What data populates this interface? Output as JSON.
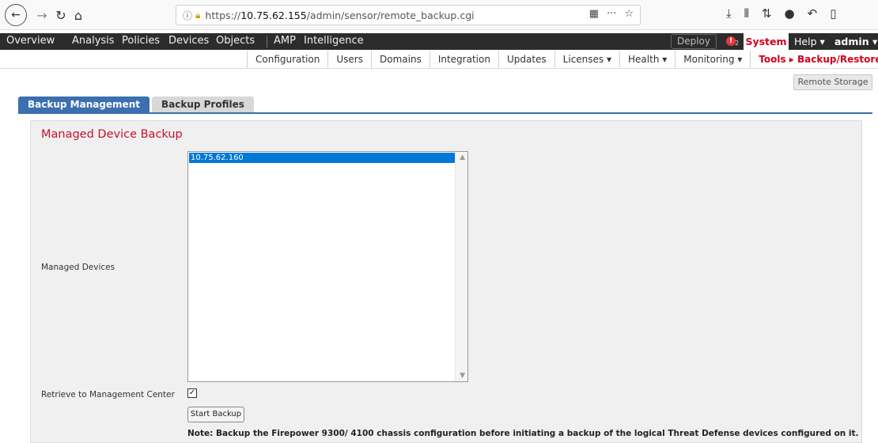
{
  "browser": {
    "url_prefix": "https://",
    "url_host": "10.75.62.155",
    "url_path": "/admin/sensor/remote_backup.cgi",
    "icons": [
      "back-icon",
      "forward-icon",
      "reload-icon",
      "home-icon",
      "info-icon",
      "lock-icon",
      "qr-icon",
      "more-icon",
      "star-icon",
      "download-icon",
      "library-icon",
      "sync-icon",
      "chat-icon",
      "undo-icon",
      "sidebar-icon"
    ]
  },
  "topnav": {
    "items": [
      "Overview",
      "Analysis",
      "Policies",
      "Devices",
      "Objects",
      "AMP",
      "Intelligence"
    ],
    "deploy_label": "Deploy",
    "alert_count": "2",
    "system_label": "System",
    "help_label": "Help ▾",
    "admin_label": "admin ▾"
  },
  "subnav": {
    "items": [
      "Configuration",
      "Users",
      "Domains",
      "Integration",
      "Updates",
      "Licenses ▾",
      "Health ▾",
      "Monitoring ▾"
    ],
    "active_label": "Tools ▸ Backup/Restore"
  },
  "remote_storage_label": "Remote Storage",
  "tabs": [
    {
      "label": "Backup Management",
      "active": true
    },
    {
      "label": "Backup Profiles",
      "active": false
    }
  ],
  "panel": {
    "title": "Managed Device Backup",
    "managed_devices_label": "Managed Devices",
    "devices": [
      "10.75.62.160"
    ],
    "retrieve_label": "Retrieve to Management Center",
    "retrieve_checked": true,
    "start_button_label": "Start Backup",
    "note": "Note: Backup the Firepower 9300/ 4100 chassis configuration before initiating a backup of the logical Threat Defense devices configured on it."
  },
  "colors": {
    "accent_red": "#c8102e",
    "tab_blue": "#3b6fb0",
    "nav_dark": "#2c2c2c",
    "selection_blue": "#0078d7"
  }
}
